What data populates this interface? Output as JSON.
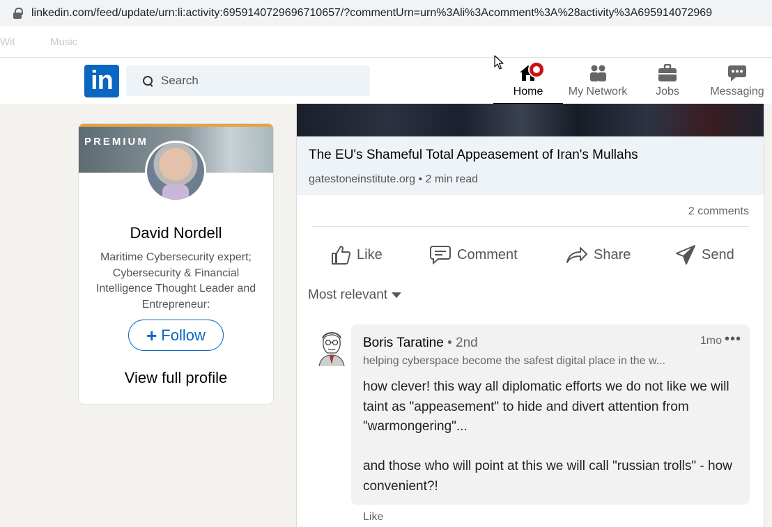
{
  "browser": {
    "url": "linkedin.com/feed/update/urn:li:activity:6959140729696710657/?commentUrn=urn%3Ali%3Acomment%3A%28activity%3A695914072969"
  },
  "bookmarks": [
    "Wit",
    "Music"
  ],
  "header": {
    "logo": "in",
    "search_placeholder": "Search",
    "nav": [
      {
        "label": "Home",
        "icon": "home-icon",
        "active": true
      },
      {
        "label": "My Network",
        "icon": "network-icon"
      },
      {
        "label": "Jobs",
        "icon": "briefcase-icon"
      },
      {
        "label": "Messaging",
        "icon": "messaging-icon"
      }
    ]
  },
  "profile": {
    "badge": "PREMIUM",
    "name": "David Nordell",
    "headline": "Maritime Cybersecurity expert; Cybersecurity & Financial Intelligence Thought Leader and Entrepreneur:",
    "follow_label": "Follow",
    "follow_plus": "+",
    "view_profile": "View full profile"
  },
  "post": {
    "article_title": "The EU's Shameful Total Appeasement of Iran's Mullahs",
    "article_source": "gatestoneinstitute.org • 2 min read",
    "comment_count": "2 comments",
    "actions": {
      "like": "Like",
      "comment": "Comment",
      "share": "Share",
      "send": "Send"
    },
    "sort_label": "Most relevant"
  },
  "comment": {
    "author": "Boris Taratine",
    "degree": " • 2nd",
    "time": "1mo",
    "more": "•••",
    "headline": "helping cyberspace become the safest digital place in the w...",
    "body": "how clever! this way all diplomatic efforts we do not like we will taint as \"appeasement\" to hide and divert attention from \"warmongering\"...\n\nand those who will point at this we will call \"russian trolls\" - how convenient?!",
    "like_label": "Like"
  },
  "colors": {
    "brand": "#0a66c2",
    "notification": "#cc1016",
    "background": "#f3f2ef"
  }
}
